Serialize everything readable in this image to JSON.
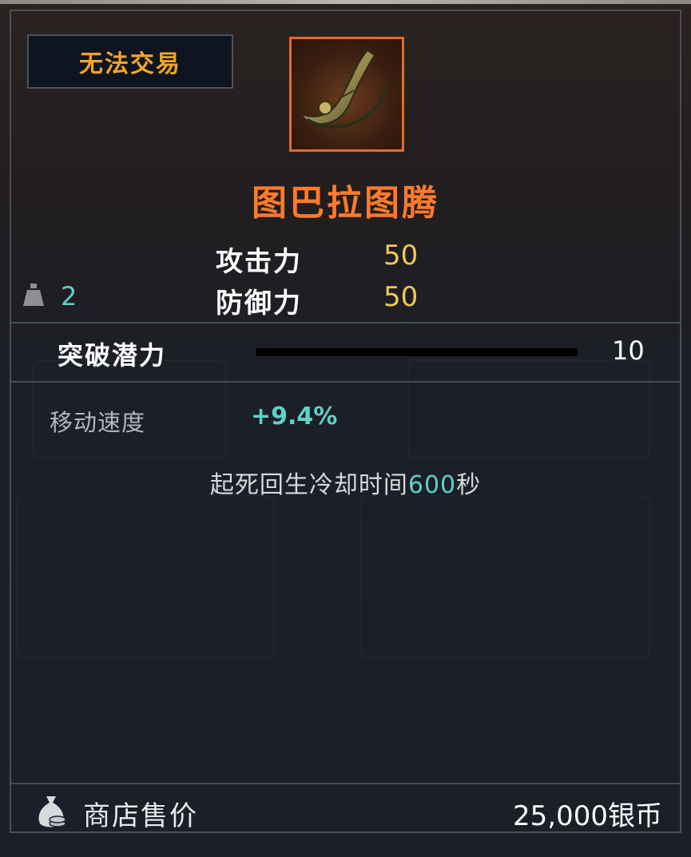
{
  "tooltip": {
    "trade_status": "无法交易",
    "item_name": "图巴拉图腾",
    "item_icon": "totem-horn-icon",
    "accent_color": "#ff7a2c",
    "stats": [
      {
        "label": "攻击力",
        "value": "50"
      },
      {
        "label": "防御力",
        "value": "50"
      }
    ],
    "weight": "2",
    "breakthrough": {
      "label": "突破潜力",
      "value": "10",
      "progress": 0.0
    },
    "effects": {
      "move_speed_label": "移动速度",
      "move_speed_value": "+9.4%",
      "revive_prefix": "起死回生冷却时间",
      "revive_number": "600",
      "revive_suffix": "秒"
    },
    "shop": {
      "label": "商店售价",
      "price": "25,000银币"
    }
  }
}
